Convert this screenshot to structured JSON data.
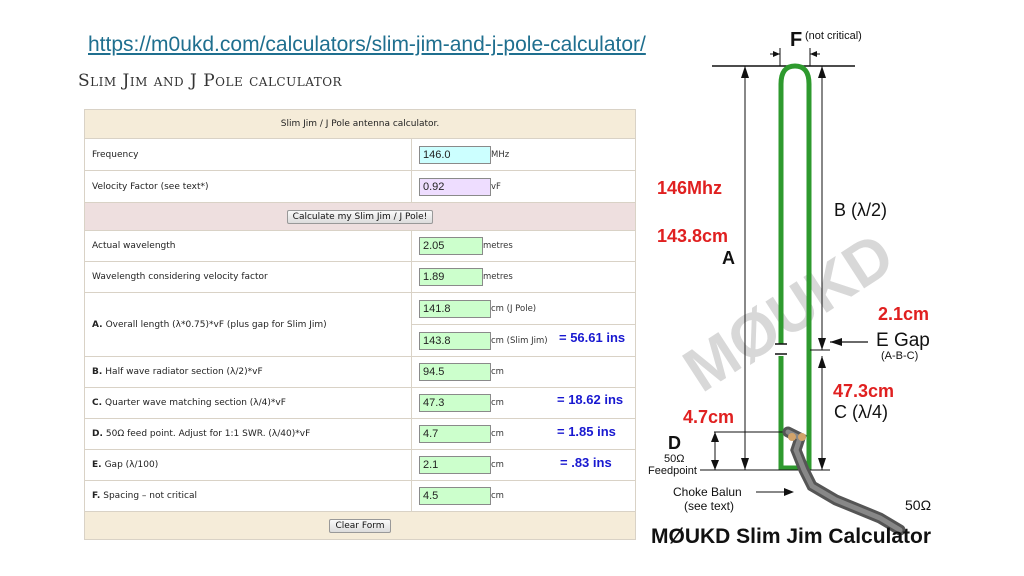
{
  "url": "https://m0ukd.com/calculators/slim-jim-and-j-pole-calculator/",
  "page_heading": "Slim Jim and J Pole calculator",
  "calculator": {
    "title": "Slim Jim / J Pole antenna calculator.",
    "frequency": {
      "label": "Frequency",
      "value": "146.0",
      "unit": "MHz"
    },
    "velocity_factor": {
      "label": "Velocity Factor (see text*)",
      "value": "0.92",
      "unit": "vF"
    },
    "calculate_button": "Calculate my Slim Jim / J Pole!",
    "actual_wavelength": {
      "label": "Actual wavelength",
      "value": "2.05",
      "unit": "metres"
    },
    "wavelength_vf": {
      "label": "Wavelength considering velocity factor",
      "value": "1.89",
      "unit": "metres"
    },
    "overall": {
      "letter": "A.",
      "label": "Overall length (λ*0.75)*vF (plus gap for Slim Jim)",
      "jpole_value": "141.8",
      "jpole_unit": "cm (J Pole)",
      "slimjim_value": "143.8",
      "slimjim_unit": "cm (Slim Jim)",
      "inches": "= 56.61 ins"
    },
    "half_wave": {
      "letter": "B.",
      "label": "Half wave radiator section (λ/2)*vF",
      "value": "94.5",
      "unit": "cm"
    },
    "quarter_wave": {
      "letter": "C.",
      "label": "Quarter wave matching section (λ/4)*vF",
      "value": "47.3",
      "unit": "cm",
      "inches": "= 18.62 ins"
    },
    "feed_point": {
      "letter": "D.",
      "label": "50Ω feed point. Adjust for 1:1 SWR. (λ/40)*vF",
      "value": "4.7",
      "unit": "cm",
      "inches": "= 1.85 ins"
    },
    "gap": {
      "letter": "E.",
      "label": "Gap (λ/100)",
      "value": "2.1",
      "unit": "cm",
      "inches": "= .83 ins"
    },
    "spacing": {
      "letter": "F.",
      "label": "Spacing – not critical",
      "value": "4.5",
      "unit": "cm"
    },
    "clear_button": "Clear Form"
  },
  "diagram": {
    "f_label": "F",
    "f_note": "(not critical)",
    "freq": "146Mhz",
    "a_value": "143.8cm",
    "a_label": "A",
    "b_label": "B (λ/2)",
    "e_value": "2.1cm",
    "e_label": "E Gap",
    "e_formula": "(A-B-C)",
    "c_value": "47.3cm",
    "c_label": "C (λ/4)",
    "d_value": "4.7cm",
    "d_label": "D",
    "d_ohm": "50Ω",
    "d_feed": "Feedpoint",
    "balun_1": "Choke Balun",
    "balun_2": "(see text)",
    "coax_ohm": "50Ω",
    "watermark": "MØUKD",
    "caption": "MØUKD Slim Jim Calculator",
    "colors": {
      "element": "#2e9a2e",
      "accent": "#e02020"
    }
  }
}
